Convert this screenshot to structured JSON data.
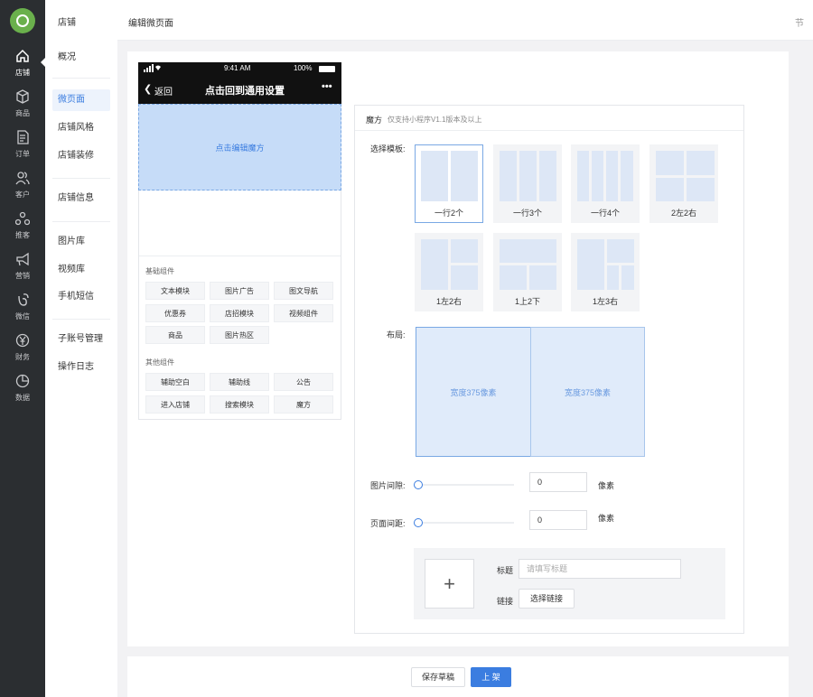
{
  "rail": {
    "items": [
      {
        "label": "店铺",
        "icon": "home-icon"
      },
      {
        "label": "商品",
        "icon": "cube-icon"
      },
      {
        "label": "订单",
        "icon": "document-icon"
      },
      {
        "label": "客户",
        "icon": "users-icon"
      },
      {
        "label": "推客",
        "icon": "share-icon"
      },
      {
        "label": "营销",
        "icon": "megaphone-icon"
      },
      {
        "label": "微信",
        "icon": "wechat-icon"
      },
      {
        "label": "财务",
        "icon": "yen-icon"
      },
      {
        "label": "数据",
        "icon": "pie-chart-icon"
      }
    ]
  },
  "sidebar": {
    "title": "店铺",
    "items": [
      "概况",
      "微页面",
      "店铺风格",
      "店铺装修",
      "店铺信息",
      "图片库",
      "视频库",
      "手机短信",
      "子账号管理",
      "操作日志"
    ]
  },
  "header": {
    "breadcrumb": "编辑微页面",
    "edge_text": "节"
  },
  "phone": {
    "signal": "…ıl ὏6",
    "time": "9:41 AM",
    "battery": "100%",
    "back": "返回",
    "title": "点击回到通用设置",
    "more": "•••",
    "cube_hint": "点击编辑魔方"
  },
  "components": {
    "basic_title": "基础组件",
    "basic": [
      "文本模块",
      "图片广告",
      "图文导航",
      "优惠券",
      "店招模块",
      "视频组件",
      "商品",
      "图片热区"
    ],
    "other_title": "其他组件",
    "other": [
      "辅助空白",
      "辅助线",
      "公告",
      "进入店铺",
      "搜索模块",
      "魔方"
    ]
  },
  "panel": {
    "heading": "魔方",
    "note": "仅支持小程序V1.1版本及以上",
    "template_label": "选择模板:",
    "templates": [
      "一行2个",
      "一行3个",
      "一行4个",
      "2左2右",
      "1左2右",
      "1上2下",
      "1左3右"
    ],
    "layout_label": "布局:",
    "cell_a": "宽度375像素",
    "cell_b": "宽度375像素",
    "gap_label": "图片间隙:",
    "gap_value": "0",
    "margin_label": "页面间距:",
    "margin_value": "0",
    "unit": "像素",
    "title_label": "标题",
    "title_placeholder": "请填写标题",
    "link_label": "链接",
    "link_button": "选择链接",
    "plus": "+"
  },
  "footer": {
    "save_draft": "保存草稿",
    "publish": "上 架"
  },
  "colors": {
    "accent": "#3b7de0",
    "rail_bg": "#2b2e31",
    "cube_bg": "#c6dcf8"
  }
}
